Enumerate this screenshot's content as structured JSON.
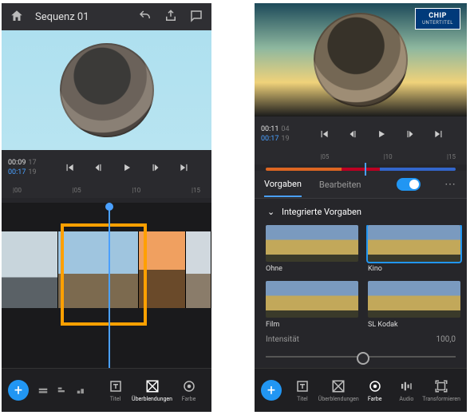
{
  "left": {
    "header": {
      "title": "Sequenz 01"
    },
    "time": {
      "current": "00:09",
      "curFrame": "17",
      "duration": "00:17",
      "durFrame": "19"
    },
    "ruler": [
      "|00",
      "|05",
      "|10",
      "|15"
    ],
    "toolbar": {
      "titel": "Titel",
      "transitions": "Überblendungen",
      "color": "Farbe"
    }
  },
  "right": {
    "chip": {
      "main": "CHIP",
      "sub": "UNTERTITEL"
    },
    "time": {
      "current": "00:11",
      "curFrame": "04",
      "duration": "00:17",
      "durFrame": "19"
    },
    "ruler": [
      "",
      "|05",
      "|10",
      "|15"
    ],
    "tabs": {
      "presets": "Vorgaben",
      "edit": "Bearbeiten"
    },
    "section": "Integrierte Vorgaben",
    "presets": [
      {
        "label": "Ohne",
        "selected": false
      },
      {
        "label": "Kino",
        "selected": true
      },
      {
        "label": "Film",
        "selected": false
      },
      {
        "label": "SL Kodak",
        "selected": false
      }
    ],
    "intensity": {
      "label": "Intensität",
      "value": "100,0"
    },
    "toolbar": {
      "titel": "Titel",
      "transitions": "Überblendungen",
      "color": "Farbe",
      "audio": "Audio",
      "transform": "Transformieren"
    }
  }
}
